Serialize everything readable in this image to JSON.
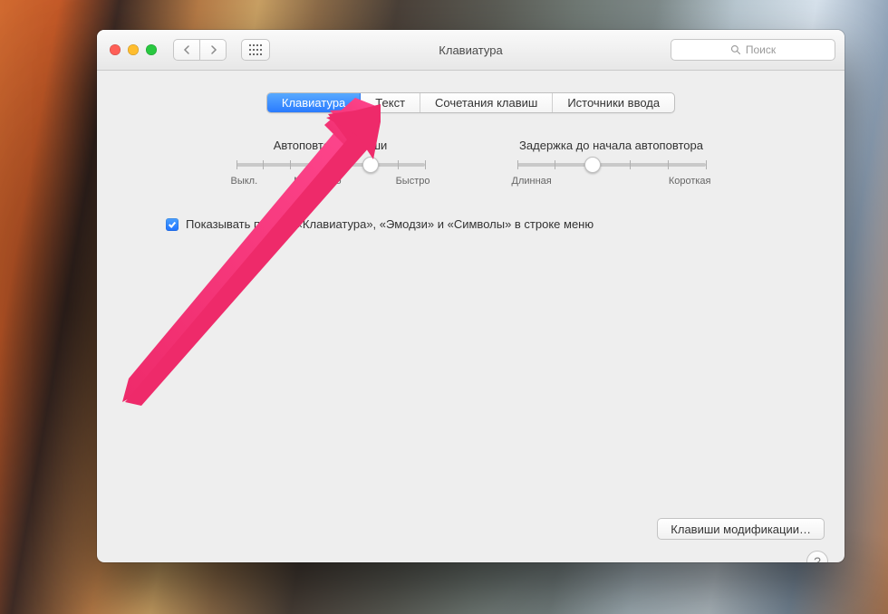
{
  "window": {
    "title": "Клавиатура"
  },
  "toolbar": {
    "search_placeholder": "Поиск"
  },
  "tabs": [
    {
      "label": "Клавиатура",
      "active": true
    },
    {
      "label": "Текст"
    },
    {
      "label": "Сочетания клавиш"
    },
    {
      "label": "Источники ввода"
    }
  ],
  "sliders": {
    "repeat": {
      "title": "Автоповтор клавиши",
      "min_label": "Выкл.",
      "mid_label": "Медленно",
      "max_label": "Быстро",
      "ticks": 8,
      "value_index": 5
    },
    "delay": {
      "title": "Задержка до начала автоповтора",
      "min_label": "Длинная",
      "max_label": "Короткая",
      "ticks": 6,
      "value_index": 2
    }
  },
  "checkbox": {
    "checked": true,
    "label": "Показывать панели «Клавиатура», «Эмодзи» и «Символы» в строке меню"
  },
  "buttons": {
    "modifier_keys": "Клавиши модификации…"
  },
  "annotation": {
    "type": "arrow",
    "color": "#ee2a6a",
    "target": "tab-text"
  }
}
